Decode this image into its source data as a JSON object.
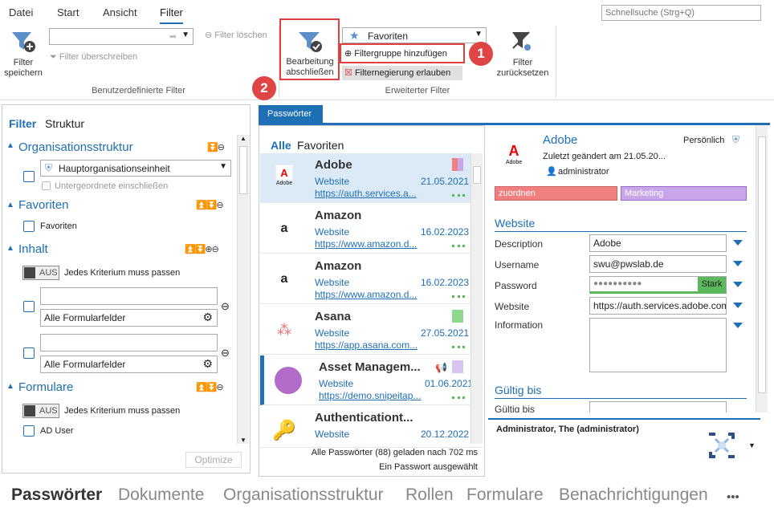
{
  "menu_tabs": [
    "Datei",
    "Start",
    "Ansicht",
    "Filter"
  ],
  "quick_search": {
    "placeholder": "Schnellsuche (Strg+Q)"
  },
  "ribbon": {
    "filter_save": "Filter\nspeichern",
    "filter_clear": "Filter löschen",
    "filter_overwrite": "Filter überschreiben",
    "group_custom": "Benutzerdefinierte Filter",
    "edit_finish": "Bearbeitung\nabschließen",
    "favorites_select": "Favoriten",
    "add_filter_group": "Filtergruppe hinzufügen",
    "allow_negation": "Filternegierung erlauben",
    "group_advanced": "Erweiterter Filter",
    "filter_reset": "Filter\nzurücksetzen",
    "badge1": "1",
    "badge2": "2"
  },
  "left": {
    "filter_tab": "Filter",
    "structure_tab": "Struktur",
    "org_title": "Organisationsstruktur",
    "org_select": "Hauptorganisationseinheit",
    "include_sub": "Untergeordnete einschließen",
    "fav_title": "Favoriten",
    "fav_check": "Favoriten",
    "content_title": "Inhalt",
    "toggle_off": "AUS",
    "must_match": "Jedes Kriterium muss passen",
    "all_fields": "Alle Formularfelder",
    "forms_title": "Formulare",
    "ad_user": "AD User",
    "optimize": "Optimize"
  },
  "list": {
    "tab": "Passwörter",
    "header_all": "Alle",
    "header_fav": "Favoriten",
    "items": [
      {
        "name": "Adobe",
        "cat": "Website",
        "date": "21.05.2021",
        "url": "https://auth.services.a..."
      },
      {
        "name": "Amazon",
        "cat": "Website",
        "date": "16.02.2023",
        "url": "https://www.amazon.d..."
      },
      {
        "name": "Amazon",
        "cat": "Website",
        "date": "16.02.2023",
        "url": "https://www.amazon.d..."
      },
      {
        "name": "Asana",
        "cat": "Website",
        "date": "27.05.2021",
        "url": "https://app.asana.com..."
      },
      {
        "name": "Asset Managem...",
        "cat": "Website",
        "date": "01.06.2021",
        "url": "https://demo.snipeitap..."
      },
      {
        "name": "Authenticationt...",
        "cat": "Website",
        "date": "20.12.2022",
        "url": ""
      }
    ],
    "status1": "Alle Passwörter (88) geladen nach 702 ms",
    "status2": "Ein Passwort ausgewählt"
  },
  "detail": {
    "title": "Adobe",
    "personal": "Persönlich",
    "changed": "Zuletzt geändert am 21.05.20...",
    "user": "administrator",
    "tag1": "zuordnen",
    "tag2": "Marketing",
    "section_website": "Website",
    "description_lbl": "Description",
    "description_val": "Adobe",
    "username_lbl": "Username",
    "username_val": "swu@pwslab.de",
    "password_lbl": "Password",
    "password_val": "●●●●●●●●●●",
    "strength": "Stark",
    "website_lbl": "Website",
    "website_val": "https://auth.services.adobe.com",
    "information_lbl": "Information",
    "valid_section": "Gültig bis",
    "valid_lbl": "Gültig bis",
    "footer_user": "Administrator, The (administrator)"
  },
  "bottom_nav": [
    "Passwörter",
    "Dokumente",
    "Organisationsstruktur",
    "Rollen",
    "Formulare",
    "Benachrichtigungen",
    "•••"
  ],
  "colors": {
    "accent": "#1e6fb5",
    "tag_red": "#f08080",
    "tag_purple": "#c9a6e8",
    "strong": "#5cb85c",
    "highlight": "#e04040"
  }
}
